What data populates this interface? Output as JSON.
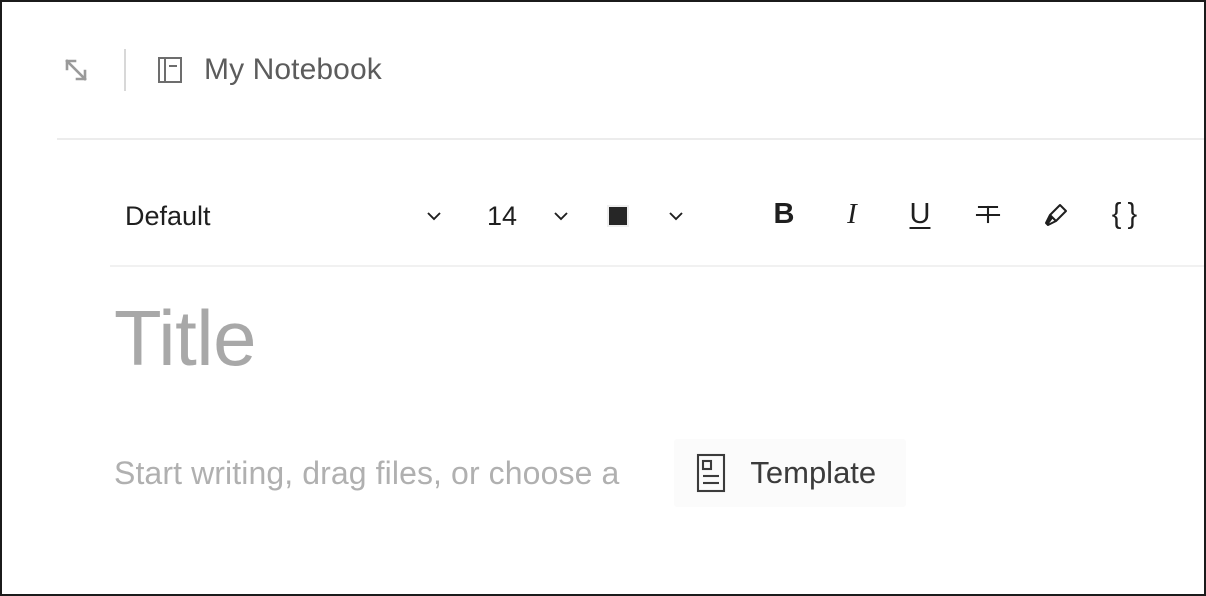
{
  "window": {
    "border_color": "#1b1b1b",
    "background": "#ffffff"
  },
  "header": {
    "expand_icon": "expand-diagonal-arrows-icon",
    "notebook_icon": "notebook-icon",
    "notebook_name": "My Notebook"
  },
  "toolbar": {
    "font_family": {
      "value": "Default",
      "chevron_icon": "chevron-down-icon"
    },
    "font_size": {
      "value": "14",
      "chevron_icon": "chevron-down-icon"
    },
    "text_color": {
      "swatch_color": "#262626",
      "chevron_icon": "chevron-down-icon"
    },
    "format_buttons": [
      {
        "name": "bold",
        "label": "B",
        "icon": "bold-icon"
      },
      {
        "name": "italic",
        "label": "I",
        "icon": "italic-icon"
      },
      {
        "name": "underline",
        "label": "U",
        "icon": "underline-icon"
      },
      {
        "name": "strikethrough",
        "label": "",
        "icon": "strikethrough-icon"
      },
      {
        "name": "highlight",
        "label": "",
        "icon": "highlighter-pen-icon"
      },
      {
        "name": "code",
        "label": "{ }",
        "icon": "code-braces-icon"
      }
    ]
  },
  "editor": {
    "title_placeholder": "Title",
    "body_placeholder": "Start writing, drag files, or choose a",
    "template_button": {
      "label": "Template",
      "icon": "template-document-icon"
    }
  },
  "colors": {
    "text_primary": "#1f1f1f",
    "text_secondary": "#5c5c5c",
    "placeholder": "#b0b0b0",
    "title_placeholder": "#a8a8a8",
    "divider": "#ececec"
  }
}
